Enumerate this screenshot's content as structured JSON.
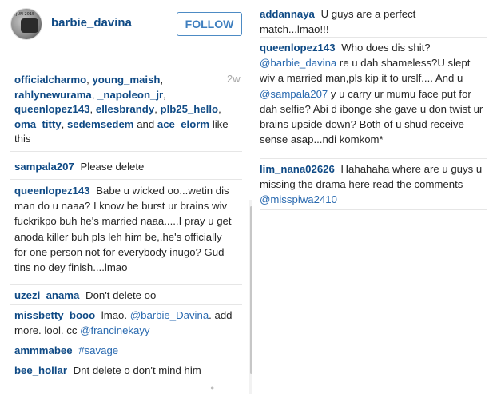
{
  "header": {
    "avatar_stamp": "JUN 2015",
    "username": "barbie_davina",
    "follow_label": "FOLLOW"
  },
  "likes": {
    "users": [
      "officialcharmo",
      "young_maish",
      "rahlynewurama",
      "_napoleon_jr",
      "queenlopez143",
      "ellesbrandy",
      "plb25_hello",
      "oma_titty",
      "sedemsedem"
    ],
    "and_text": "and",
    "last_user": "ace_elorm",
    "suffix": "like this",
    "age": "2w"
  },
  "comments_left": [
    {
      "user": "sampala207",
      "text": "Please delete"
    },
    {
      "user": "queenlopez143",
      "text": "Babe u wicked oo...wetin dis man do u naaa? I know he burst ur brains wiv fuckrikpo buh he's married naaa.....I pray u get anoda killer buh pls leh him be,,he's officially for one person not for everybody inugo? Gud tins no dey finish....lmao"
    },
    {
      "user": "uzezi_anama",
      "text": "Don't delete oo"
    },
    {
      "user": "missbetty_booo",
      "text_a": "lmao.",
      "mention_a": "@barbie_Davina",
      "text_b": ". add more. lool. cc",
      "mention_b": "@francinekayy"
    },
    {
      "user": "ammmabee",
      "hashtag": "#savage"
    },
    {
      "user": "bee_hollar",
      "text": "Dnt delete o don't mind him"
    }
  ],
  "comments_right": [
    {
      "user": "addannaya",
      "text": "U guys are a perfect match...lmao!!!"
    },
    {
      "user": "queenlopez143",
      "text_a": "Who does dis shit?",
      "mention_a": "@barbie_davina",
      "text_b": "re u dah shameless?U slept wiv a married man,pls kip it to urslf.... And u",
      "mention_b": "@sampala207",
      "text_c": "y u carry ur mumu face put for dah selfie? Abi d ibonge she gave u don twist ur brains upside down? Both of u shud receive sense asap...ndi komkom*"
    },
    {
      "user": "lim_nana02626",
      "text": "Hahahaha where are u guys u missing the drama here read the comments",
      "mention": "@misspiwa2410"
    }
  ]
}
